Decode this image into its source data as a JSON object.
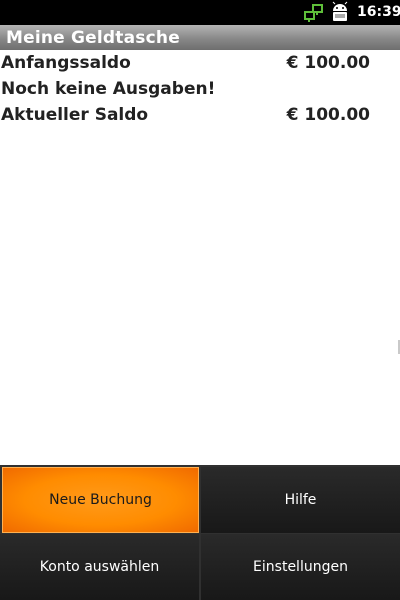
{
  "status_bar": {
    "time": "16:39",
    "icons": [
      "network-sync-icon",
      "android-robot-icon"
    ]
  },
  "title_bar": {
    "title": "Meine Geldtasche"
  },
  "content": {
    "rows": [
      {
        "label": "Anfangssaldo",
        "amount": "€ 100.00"
      },
      {
        "label": "Noch keine Ausgaben!",
        "amount": ""
      },
      {
        "label": "Aktueller Saldo",
        "amount": "€ 100.00"
      }
    ]
  },
  "menu": {
    "items": [
      {
        "label": "Neue Buchung",
        "selected": true
      },
      {
        "label": "Hilfe",
        "selected": false
      },
      {
        "label": "Konto auswählen",
        "selected": false
      },
      {
        "label": "Einstellungen",
        "selected": false
      }
    ]
  },
  "colors": {
    "menu_selected": "#ff8c00",
    "menu_background": "#1e1e1e",
    "title_bar": "#888888",
    "status_bar": "#000000"
  }
}
